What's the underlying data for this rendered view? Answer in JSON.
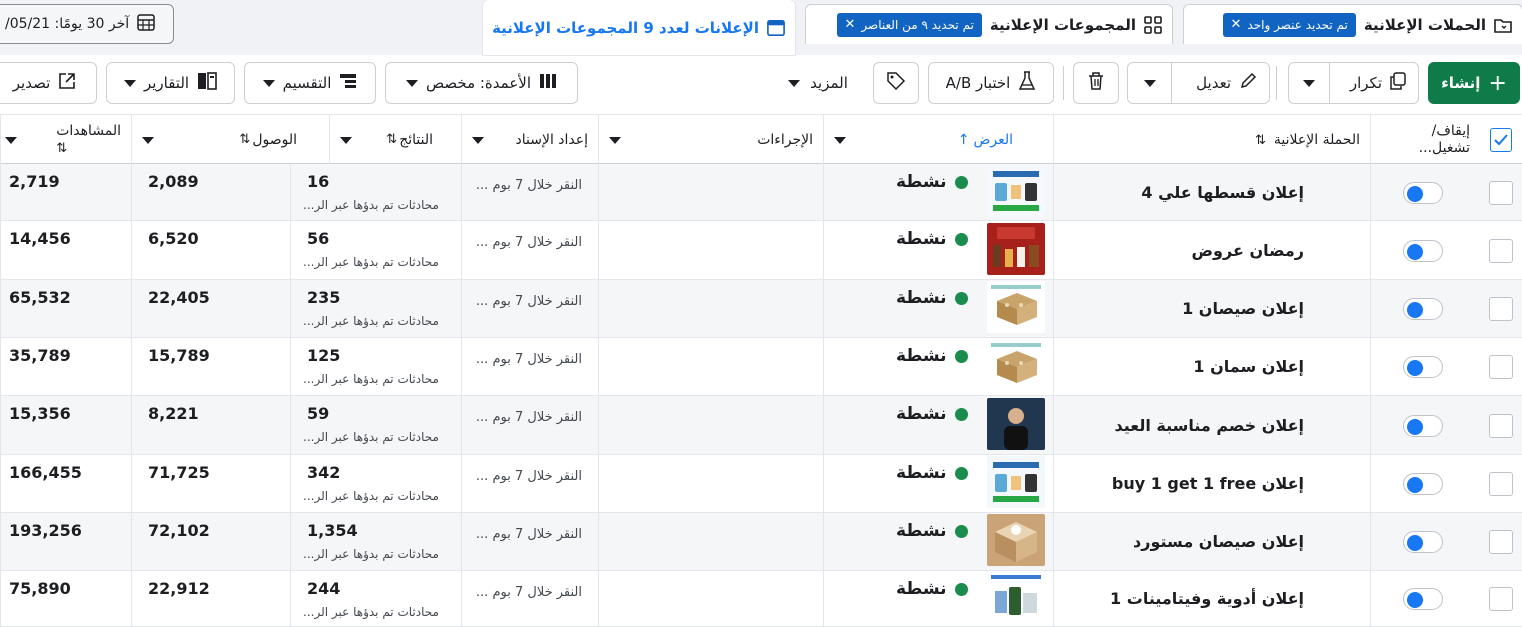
{
  "tabs": {
    "campaigns": {
      "label": "الحملات الإعلانية",
      "chip": "تم تحديد عنصر واحد",
      "icon": "folder-icon"
    },
    "adsets": {
      "label": "المجموعات الإعلانية",
      "chip": "تم تحديد ٩ من العناصر",
      "icon": "grid-icon"
    },
    "ads": {
      "label": "الإعلانات لعدد 9 المجموعات الإعلانية",
      "icon": "ad-card-icon"
    }
  },
  "date_range": {
    "label": "آخر 30 يومًا: 05/21/",
    "icon": "calendar-icon"
  },
  "toolbar": {
    "create": "إنشاء",
    "duplicate": "تكرار",
    "edit": "تعديل",
    "ab_test": "اختبار A/B",
    "more": "المزيد",
    "columns": "الأعمدة: مخصص",
    "breakdown": "التقسيم",
    "reports": "التقارير",
    "export": "تصدير"
  },
  "columns": {
    "toggle": "إيقاف/ تشغيل...",
    "campaign": "الحملة الإعلانية",
    "delivery": "العرض",
    "actions": "الإجراءات",
    "attribution": "إعداد الإسناد",
    "results": "النتائج",
    "reach": "الوصول",
    "impressions": "المشاهدات"
  },
  "colors": {
    "accent": "#1877f2",
    "create_green": "#0e7b48",
    "chip_blue": "#1264c2",
    "active_dot": "#1a8c4d"
  },
  "rows": [
    {
      "name": "إعلان قسطها علي 4",
      "delivery": "نشطة",
      "attribution": "النقر خلال 7 بوم ...",
      "results": "16",
      "results_label": "محادثات تم بدؤها عبر الر...",
      "reach": "2,089",
      "impressions": "2,719",
      "thumb": "white-product-ad"
    },
    {
      "name": "رمضان عروض",
      "delivery": "نشطة",
      "attribution": "النقر خلال 7 بوم ...",
      "results": "56",
      "results_label": "محادثات تم بدؤها عبر الر...",
      "reach": "6,520",
      "impressions": "14,456",
      "thumb": "red-offers-ad"
    },
    {
      "name": "إعلان صيصان 1",
      "delivery": "نشطة",
      "attribution": "النقر خلال 7 بوم ...",
      "results": "235",
      "results_label": "محادثات تم بدؤها عبر الر...",
      "reach": "22,405",
      "impressions": "65,532",
      "thumb": "box-ad"
    },
    {
      "name": "إعلان سمان 1",
      "delivery": "نشطة",
      "attribution": "النقر خلال 7 بوم ...",
      "results": "125",
      "results_label": "محادثات تم بدؤها عبر الر...",
      "reach": "15,789",
      "impressions": "35,789",
      "thumb": "box-ad"
    },
    {
      "name": "إعلان خصم مناسبة العيد",
      "delivery": "نشطة",
      "attribution": "النقر خلال 7 بوم ...",
      "results": "59",
      "results_label": "محادثات تم بدؤها عبر الر...",
      "reach": "8,221",
      "impressions": "15,356",
      "thumb": "video-person-ad"
    },
    {
      "name": "إعلان buy 1 get 1 free",
      "delivery": "نشطة",
      "attribution": "النقر خلال 7 بوم ...",
      "results": "342",
      "results_label": "محادثات تم بدؤها عبر الر...",
      "reach": "71,725",
      "impressions": "166,455",
      "thumb": "white-product-ad"
    },
    {
      "name": "إعلان صيصان مستورد",
      "delivery": "نشطة",
      "attribution": "النقر خلال 7 بوم ...",
      "results": "1,354",
      "results_label": "محادثات تم بدؤها عبر الر...",
      "reach": "72,102",
      "impressions": "193,256",
      "thumb": "cardboard-ad"
    },
    {
      "name": "إعلان أدوية وفيتامينات 1",
      "delivery": "نشطة",
      "attribution": "النقر خلال 7 بوم ...",
      "results": "244",
      "results_label": "محادثات تم بدؤها عبر الر...",
      "reach": "22,912",
      "impressions": "75,890",
      "thumb": "medicine-ad"
    }
  ]
}
